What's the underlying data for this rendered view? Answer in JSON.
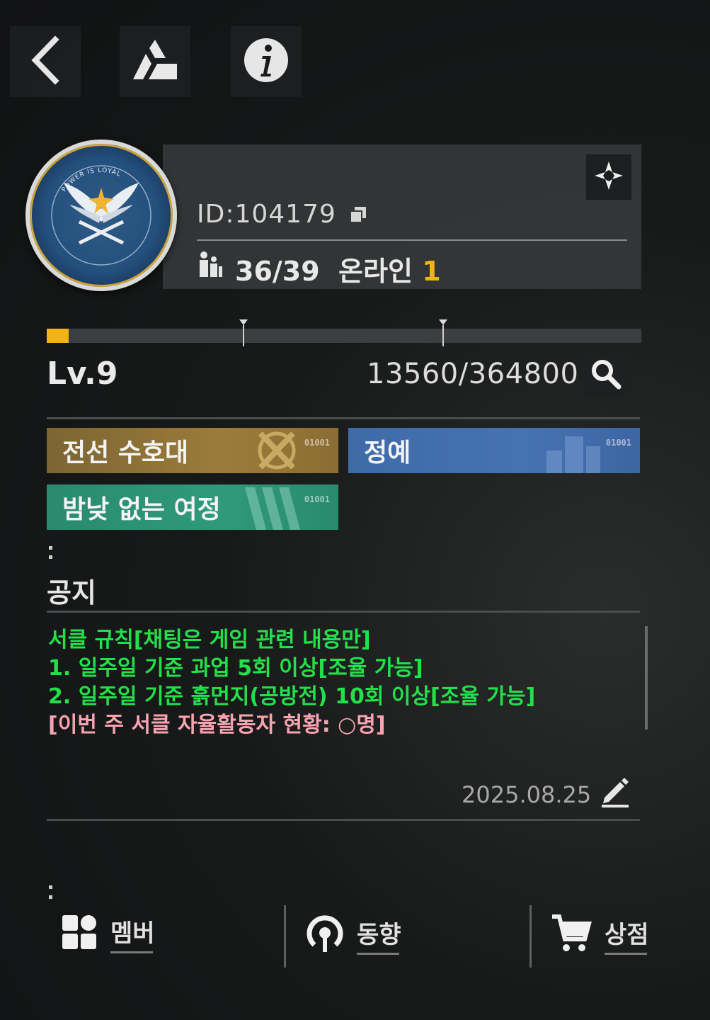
{
  "header": {
    "back_icon": "chevron-left-icon",
    "brand_icon": "delta-logo-icon",
    "info_icon": "info-circle-icon"
  },
  "club": {
    "id_text": "ID:104179",
    "copy_icon": "copy-icon",
    "members_text": "36/39",
    "online_label": "온라인",
    "online_count": "1",
    "emblem_motto": "POWER IS LOYAL"
  },
  "level": {
    "label": "Lv.9",
    "exp_text": "13560/364800",
    "progress_fraction": 0.0372
  },
  "tags": [
    {
      "label": "전선 수호대",
      "code": "01001",
      "color": "#9b7c3a"
    },
    {
      "label": "정예",
      "code": "01001",
      "color": "#4772b2"
    },
    {
      "label": "밤낮 없는 여정",
      "code": "01001",
      "color": "#2f9a7a"
    }
  ],
  "notice": {
    "title": "공지",
    "lines": [
      "서클 규칙[채팅은 게임 관련 내용만]",
      "1. 일주일 기준 과업 5회 이상[조율 가능]",
      "2. 일주일 기준 흙먼지(공방전) 10회 이상[조율 가능]",
      "[이번 주 서클 자율활동자 현황: ○명]"
    ],
    "date": "2025.08.25"
  },
  "nav": [
    {
      "label": "멤버",
      "icon": "grid-icon"
    },
    {
      "label": "동향",
      "icon": "signal-icon"
    },
    {
      "label": "상점",
      "icon": "cart-icon"
    }
  ]
}
